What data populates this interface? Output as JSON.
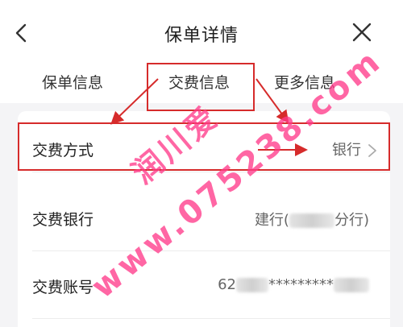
{
  "header": {
    "title": "保单详情",
    "back_icon": "chevron-left-icon",
    "close_icon": "close-icon"
  },
  "tabs": [
    {
      "label": "保单信息",
      "active": false
    },
    {
      "label": "交费信息",
      "active": true
    },
    {
      "label": "更多信息",
      "active": false
    }
  ],
  "rows": {
    "method": {
      "label": "交费方式",
      "value": "银行"
    },
    "bank": {
      "label": "交费银行",
      "value_prefix": "建行(",
      "value_suffix": "分行)"
    },
    "account": {
      "label": "交费账号",
      "value_prefix": "62",
      "value_middle": "*********"
    }
  },
  "watermark": {
    "text": "www.075238.com",
    "brand": "润川爱",
    "color": "#ff3b8a"
  },
  "colors": {
    "annotation_red": "#d62b2b",
    "background": "#f4f4f6"
  }
}
